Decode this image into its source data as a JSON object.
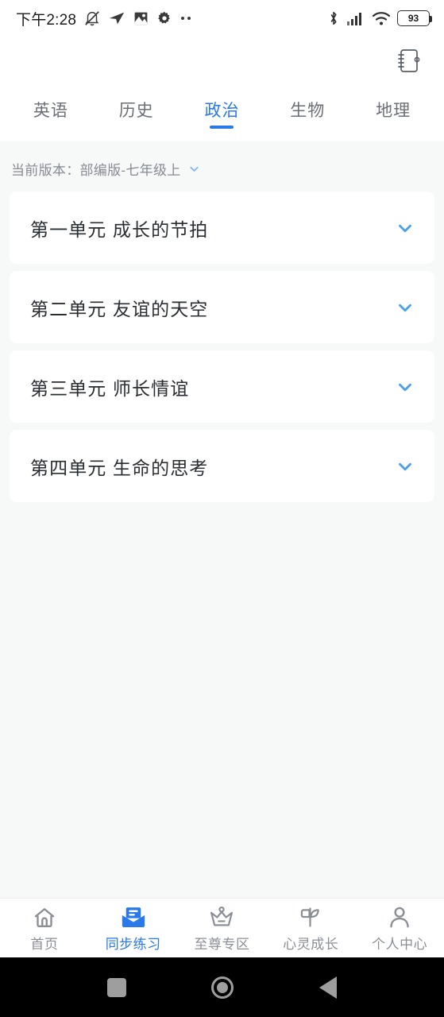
{
  "status_bar": {
    "time": "下午2:28",
    "battery_percent": "93",
    "left_icons": [
      "bell-muted-icon",
      "paper-plane-icon",
      "gallery-icon",
      "gear-icon",
      "ellipsis-icon"
    ],
    "right_icons": [
      "bluetooth-icon",
      "signal-icon",
      "wifi-icon",
      "battery-icon"
    ]
  },
  "header": {
    "notebook_icon": "notebook-icon"
  },
  "tabs": [
    {
      "label": "英语",
      "active": false
    },
    {
      "label": "历史",
      "active": false
    },
    {
      "label": "政治",
      "active": true
    },
    {
      "label": "生物",
      "active": false
    },
    {
      "label": "地理",
      "active": false
    }
  ],
  "version_selector": {
    "text": "当前版本：部编版-七年级上",
    "chevron_icon": "chevron-down-icon"
  },
  "units": [
    {
      "title": "第一单元 成长的节拍",
      "chevron_icon": "chevron-down-icon"
    },
    {
      "title": "第二单元 友谊的天空",
      "chevron_icon": "chevron-down-icon"
    },
    {
      "title": "第三单元 师长情谊",
      "chevron_icon": "chevron-down-icon"
    },
    {
      "title": "第四单元 生命的思考",
      "chevron_icon": "chevron-down-icon"
    }
  ],
  "bottom_nav": [
    {
      "label": "首页",
      "icon": "home-icon",
      "active": false
    },
    {
      "label": "同步练习",
      "icon": "book-practice-icon",
      "active": true
    },
    {
      "label": "至尊专区",
      "icon": "crown-icon",
      "active": false
    },
    {
      "label": "心灵成长",
      "icon": "sprout-icon",
      "active": false
    },
    {
      "label": "个人中心",
      "icon": "person-icon",
      "active": false
    }
  ],
  "system_nav": [
    {
      "icon": "recents-square-icon"
    },
    {
      "icon": "home-circle-icon"
    },
    {
      "icon": "back-triangle-icon"
    }
  ],
  "colors": {
    "accent": "#2979E8",
    "chevron": "#4A9FE8",
    "page_background": "#F7F8F8",
    "card_background": "#FFFFFF",
    "text_primary": "#2A2D31",
    "text_muted": "#868B92"
  }
}
